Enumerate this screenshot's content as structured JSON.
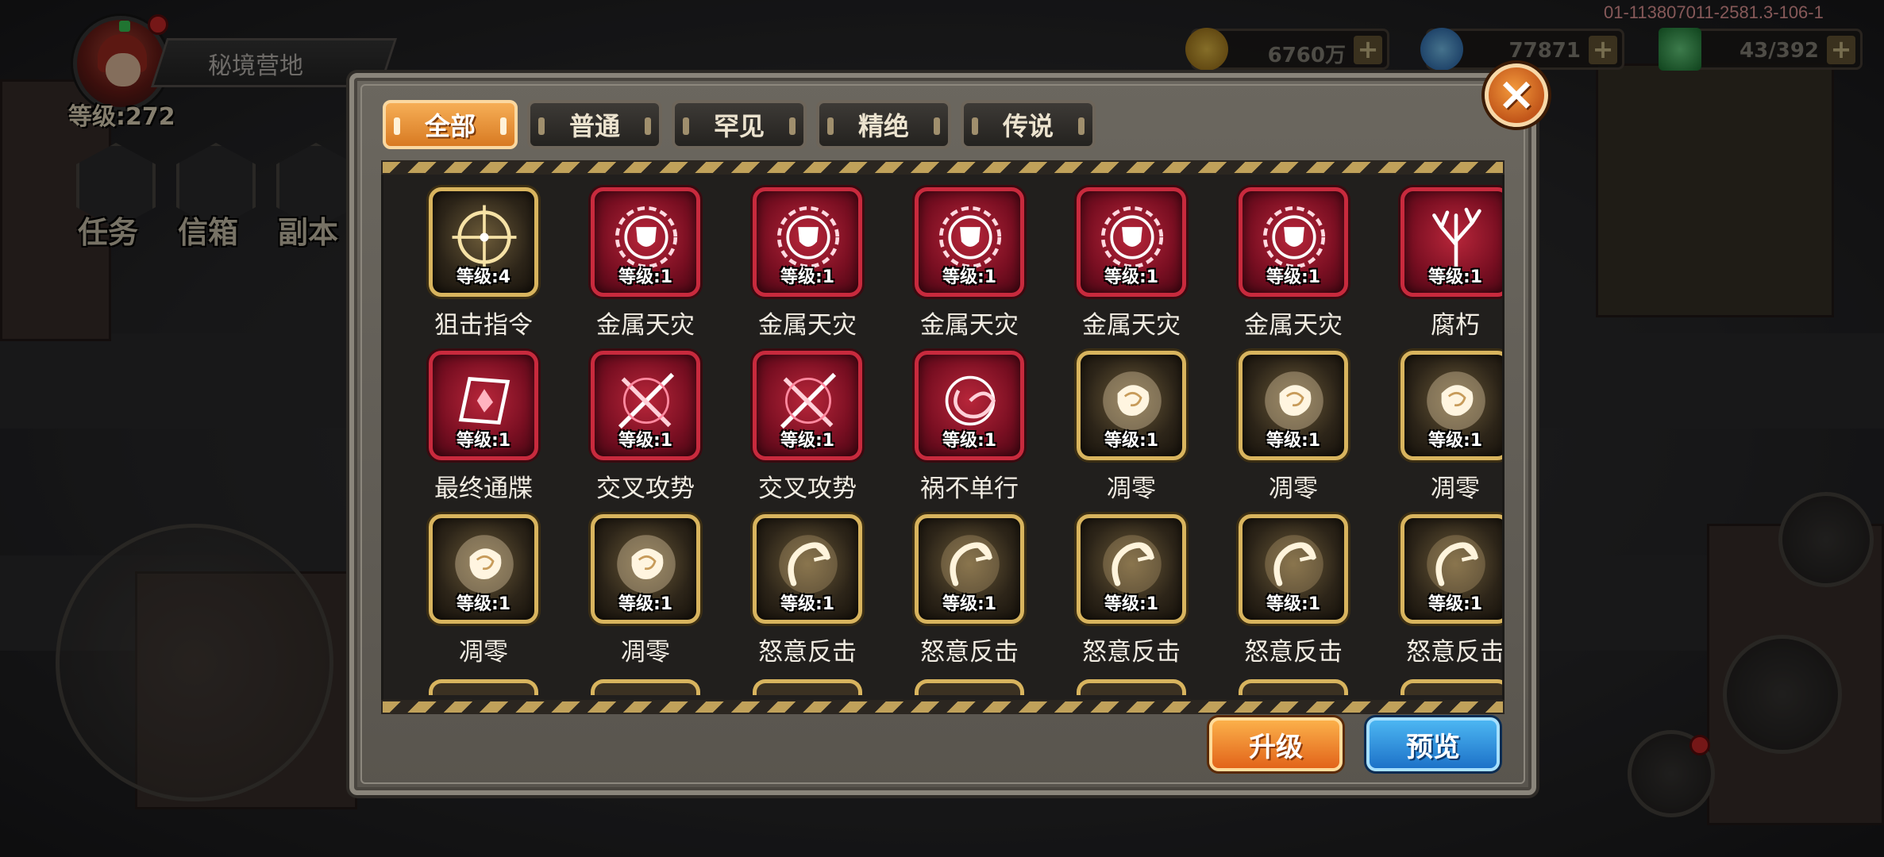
{
  "hud": {
    "location": "秘境营地",
    "level": "等级:272",
    "buttons": [
      "任务",
      "信箱",
      "副本"
    ],
    "build_id": "01-113807011-2581.3-106-1",
    "resources": [
      {
        "icon": "gold-coin-icon",
        "value": "6760万",
        "color": "#d8a52a"
      },
      {
        "icon": "blue-gem-icon",
        "value": "77871",
        "color": "#3a8ad8"
      },
      {
        "icon": "green-crystal-icon",
        "value": "43/392",
        "color": "#2fae4a"
      }
    ]
  },
  "modal": {
    "tabs": [
      "全部",
      "普通",
      "罕见",
      "精绝",
      "传说"
    ],
    "active_tab": "全部",
    "close": "×",
    "upgrade_label": "升级",
    "preview_label": "预览",
    "skills": [
      {
        "name": "狙击指令",
        "level": "等级:4",
        "rarity": "gold",
        "icon": "crosshair-icon"
      },
      {
        "name": "金属天灾",
        "level": "等级:1",
        "rarity": "red",
        "icon": "metal-shield-icon"
      },
      {
        "name": "金属天灾",
        "level": "等级:1",
        "rarity": "red",
        "icon": "metal-shield-icon"
      },
      {
        "name": "金属天灾",
        "level": "等级:1",
        "rarity": "red",
        "icon": "metal-shield-icon"
      },
      {
        "name": "金属天灾",
        "level": "等级:1",
        "rarity": "red",
        "icon": "metal-shield-icon"
      },
      {
        "name": "金属天灾",
        "level": "等级:1",
        "rarity": "red",
        "icon": "metal-shield-icon"
      },
      {
        "name": "腐朽",
        "level": "等级:1",
        "rarity": "red",
        "icon": "withered-tree-icon"
      },
      {
        "name": "最终通牒",
        "level": "等级:1",
        "rarity": "red",
        "icon": "card-icon"
      },
      {
        "name": "交叉攻势",
        "level": "等级:1",
        "rarity": "red",
        "icon": "crossed-blades-icon"
      },
      {
        "name": "交叉攻势",
        "level": "等级:1",
        "rarity": "red",
        "icon": "crossed-blades-icon"
      },
      {
        "name": "祸不单行",
        "level": "等级:1",
        "rarity": "red",
        "icon": "vortex-icon"
      },
      {
        "name": "凋零",
        "level": "等级:1",
        "rarity": "gold",
        "icon": "rose-icon"
      },
      {
        "name": "凋零",
        "level": "等级:1",
        "rarity": "gold",
        "icon": "rose-icon"
      },
      {
        "name": "凋零",
        "level": "等级:1",
        "rarity": "gold",
        "icon": "rose-icon"
      },
      {
        "name": "凋零",
        "level": "等级:1",
        "rarity": "gold",
        "icon": "rose-icon"
      },
      {
        "name": "凋零",
        "level": "等级:1",
        "rarity": "gold",
        "icon": "rose-icon"
      },
      {
        "name": "怒意反击",
        "level": "等级:1",
        "rarity": "gold",
        "icon": "claw-slash-icon"
      },
      {
        "name": "怒意反击",
        "level": "等级:1",
        "rarity": "gold",
        "icon": "claw-slash-icon"
      },
      {
        "name": "怒意反击",
        "level": "等级:1",
        "rarity": "gold",
        "icon": "claw-slash-icon"
      },
      {
        "name": "怒意反击",
        "level": "等级:1",
        "rarity": "gold",
        "icon": "claw-slash-icon"
      },
      {
        "name": "怒意反击",
        "level": "等级:1",
        "rarity": "gold",
        "icon": "claw-slash-icon"
      }
    ]
  }
}
